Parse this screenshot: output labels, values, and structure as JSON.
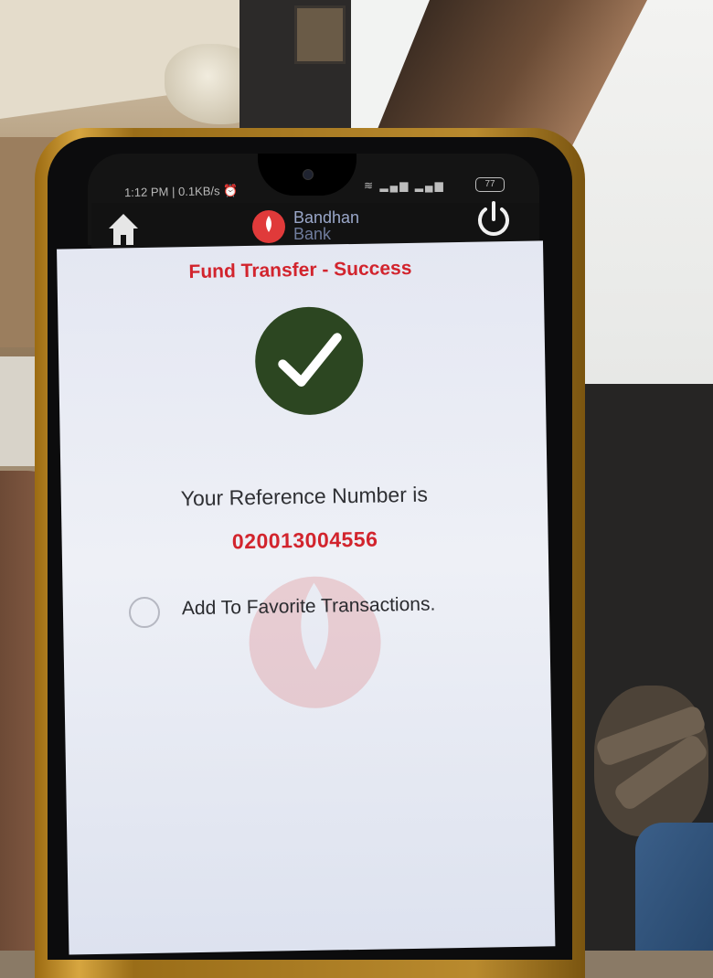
{
  "status_bar": {
    "time": "1:12 PM",
    "speed": "0.1KB/s",
    "battery": "77"
  },
  "app_bar": {
    "home_icon": "home-icon",
    "logo_line1": "Bandhan",
    "logo_line2": "Bank",
    "power_icon": "power-icon"
  },
  "main": {
    "title": "Fund Transfer - Success",
    "success_icon": "check-circle-icon",
    "reference_label": "Your Reference Number is",
    "reference_number": "020013004556",
    "favorite_label": "Add To Favorite Transactions."
  },
  "colors": {
    "accent_red": "#d2242d",
    "success_green": "#2c4621",
    "appbar_bg": "#121212",
    "screen_bg": "#e4e7f2"
  }
}
